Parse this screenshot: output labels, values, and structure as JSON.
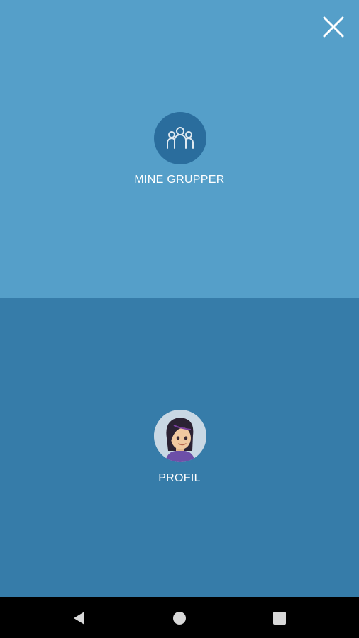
{
  "menu": {
    "groups_label": "MINE GRUPPER",
    "profile_label": "PROFIL"
  },
  "icons": {
    "close": "close-icon",
    "groups": "group-people-icon",
    "profile": "profile-avatar",
    "nav_back": "back-triangle-icon",
    "nav_home": "home-circle-icon",
    "nav_recent": "recent-apps-square-icon"
  },
  "colors": {
    "top_panel": "#559fc9",
    "bottom_panel": "#367ca9",
    "groups_circle": "#2a6d9d",
    "nav_bar": "#000000"
  }
}
